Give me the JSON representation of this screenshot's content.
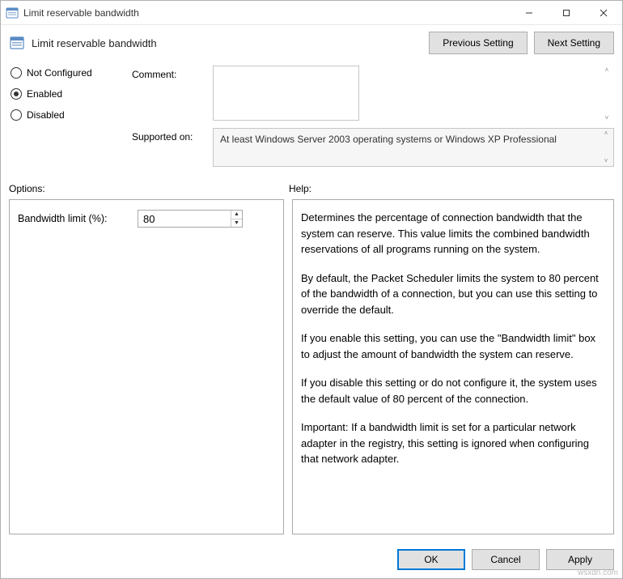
{
  "window": {
    "title": "Limit reservable bandwidth"
  },
  "header": {
    "policy_title": "Limit reservable bandwidth",
    "previous_btn": "Previous Setting",
    "next_btn": "Next Setting"
  },
  "radios": {
    "not_configured": "Not Configured",
    "enabled": "Enabled",
    "disabled": "Disabled",
    "selected": "enabled"
  },
  "fields": {
    "comment_label": "Comment:",
    "comment_value": "",
    "supported_label": "Supported on:",
    "supported_value": "At least Windows Server 2003 operating systems or Windows XP Professional"
  },
  "sections": {
    "options_label": "Options:",
    "help_label": "Help:"
  },
  "options": {
    "bandwidth_label": "Bandwidth limit (%):",
    "bandwidth_value": "80"
  },
  "help": {
    "p1": "Determines the percentage of connection bandwidth that the system can reserve. This value limits the combined bandwidth reservations of all programs running on the system.",
    "p2": "By default, the Packet Scheduler limits the system to 80 percent of the bandwidth of a connection, but you can use this setting to override the default.",
    "p3": "If you enable this setting, you can use the \"Bandwidth limit\" box to adjust the amount of bandwidth the system can reserve.",
    "p4": "If you disable this setting or do not configure it, the system uses the default value of 80 percent of the connection.",
    "p5": "Important: If a bandwidth limit is set for a particular network adapter in the registry, this setting is ignored when configuring that network adapter."
  },
  "buttons": {
    "ok": "OK",
    "cancel": "Cancel",
    "apply": "Apply"
  },
  "watermark": "wsxdn.com"
}
